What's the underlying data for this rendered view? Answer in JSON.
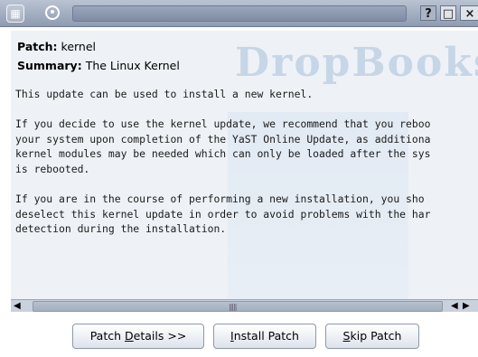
{
  "window": {
    "menu_icon": "window-menu-icon",
    "app_icon": "suse-gecko-icon",
    "controls": {
      "help": "?",
      "maximize": "□",
      "close": "×"
    }
  },
  "watermark": {
    "text": "DropBooks"
  },
  "patch": {
    "name_label": "Patch:",
    "name_value": "kernel",
    "summary_label": "Summary:",
    "summary_value": "The Linux Kernel",
    "description_lines": [
      "This update can be used to install a new kernel.",
      "",
      "If you decide to use the kernel update, we recommend that you reboo",
      "your system upon completion of the YaST Online Update, as additiona",
      "kernel modules may be needed which can only be loaded after the sys",
      "is rebooted.",
      "",
      "If you are in the course of performing a new installation, you sho",
      "deselect this kernel update in order to avoid problems with the har",
      "detection during the installation."
    ]
  },
  "buttons": {
    "details_pre": "Patch ",
    "details_key": "D",
    "details_post": "etails >>",
    "install_key": "I",
    "install_post": "nstall Patch",
    "skip_key": "S",
    "skip_post": "kip Patch"
  },
  "colors": {
    "titlebar": "#8e9bb1",
    "content_bg": "#eef2f7"
  }
}
